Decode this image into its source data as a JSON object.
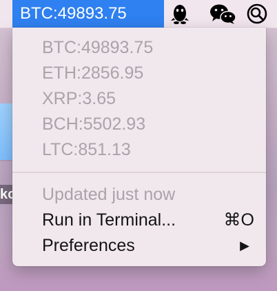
{
  "menubar": {
    "status_text": "BTC:49893.75",
    "tray_icons": [
      "qq-penguin-icon",
      "wechat-icon",
      "search-magnifier-icon"
    ]
  },
  "menu": {
    "prices": [
      {
        "label": "BTC:49893.75"
      },
      {
        "label": "ETH:2856.95"
      },
      {
        "label": "XRP:3.65"
      },
      {
        "label": "BCH:5502.93"
      },
      {
        "label": "LTC:851.13"
      }
    ],
    "updated_label": "Updated just now",
    "run_in_terminal": {
      "label": "Run in Terminal...",
      "shortcut": "⌘O"
    },
    "preferences": {
      "label": "Preferences",
      "arrow": "▶"
    }
  },
  "desktop": {
    "partial_label": "ko"
  },
  "colors": {
    "highlight": "#2f80f0",
    "menu_bg": "#f1e8ee",
    "disabled_text": "#aaa3a8",
    "enabled_text": "#141414"
  }
}
